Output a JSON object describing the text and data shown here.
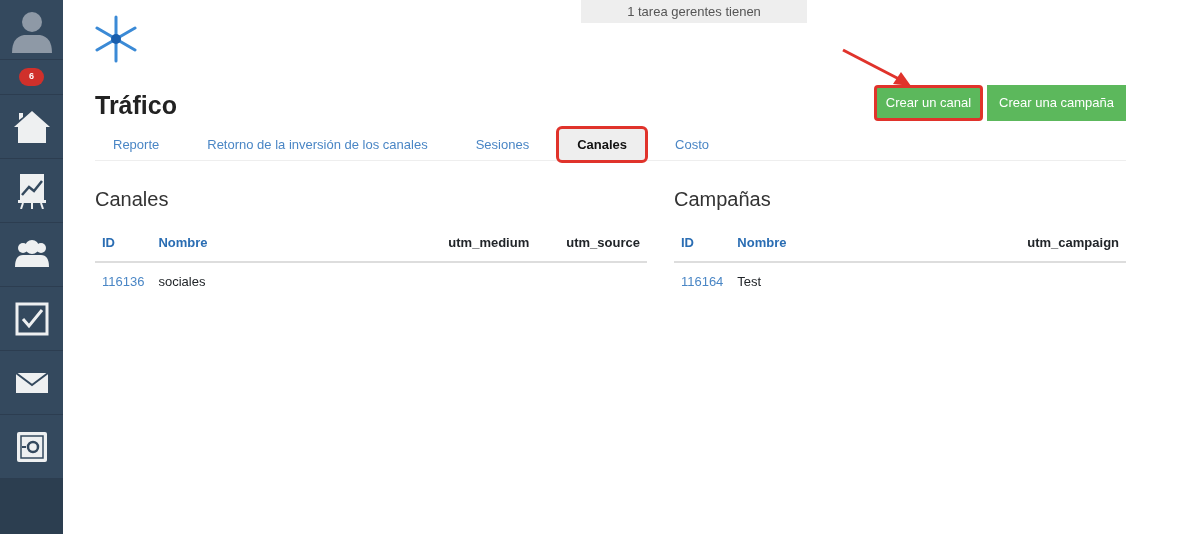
{
  "sidebar": {
    "badge": "6",
    "items": [
      {
        "kind": "home",
        "selected": false
      },
      {
        "kind": "chart",
        "selected": false
      },
      {
        "kind": "people",
        "selected": false
      },
      {
        "kind": "tasks",
        "selected": false
      },
      {
        "kind": "mail",
        "selected": false
      },
      {
        "kind": "safe",
        "selected": false
      }
    ]
  },
  "notice": "1 tarea gerentes tienen",
  "page_title": "Tráfico",
  "buttons": [
    {
      "label": "Crear un canal",
      "highlighted": true
    },
    {
      "label": "Crear una campaña",
      "highlighted": false
    }
  ],
  "tabs": [
    {
      "label": "Reporte",
      "selected": false,
      "highlighted": false
    },
    {
      "label": "Retorno de la inversión de los canales",
      "selected": false,
      "highlighted": false
    },
    {
      "label": "Sesiones",
      "selected": false,
      "highlighted": false
    },
    {
      "label": "Canales",
      "selected": true,
      "highlighted": true
    },
    {
      "label": "Costo",
      "selected": false,
      "highlighted": false
    }
  ],
  "panels": [
    {
      "title": "Canales",
      "columns": [
        {
          "label": "ID",
          "sortable": true
        },
        {
          "label": "Nombre",
          "sortable": true
        },
        {
          "label": "utm_medium",
          "sortable": false
        },
        {
          "label": "utm_source",
          "sortable": false
        }
      ],
      "rows": [
        [
          "116136",
          "sociales",
          "",
          ""
        ]
      ]
    },
    {
      "title": "Campañas",
      "columns": [
        {
          "label": "ID",
          "sortable": true
        },
        {
          "label": "Nombre",
          "sortable": true
        },
        {
          "label": "utm_campaign",
          "sortable": false
        }
      ],
      "rows": [
        [
          "116164",
          "Test",
          ""
        ]
      ]
    }
  ]
}
